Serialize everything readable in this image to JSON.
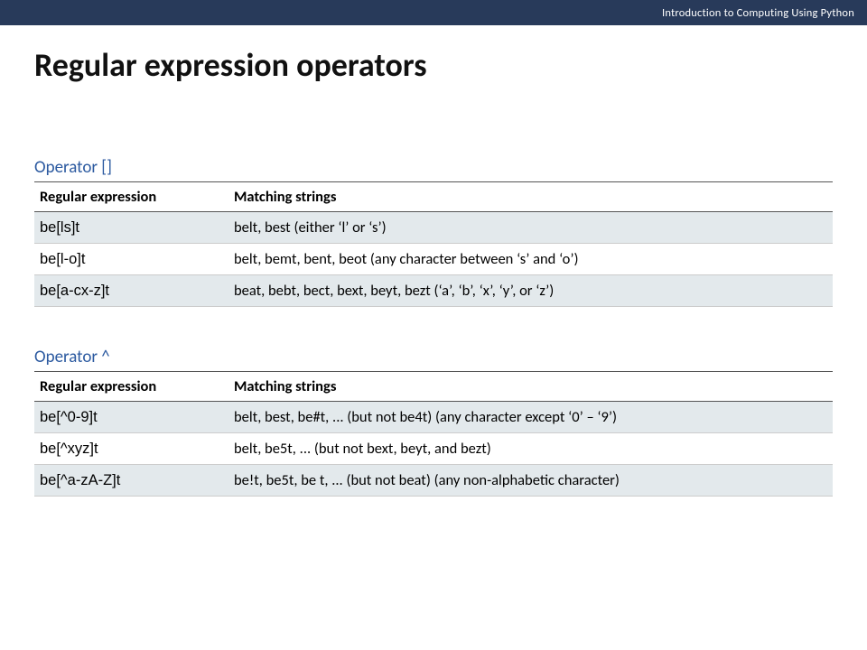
{
  "header": {
    "course": "Introduction to Computing Using Python"
  },
  "title": "Regular expression operators",
  "sections": [
    {
      "label": "Operator []",
      "columns": [
        "Regular expression",
        "Matching strings"
      ],
      "rows": [
        {
          "re": "be[ls]t",
          "match": "belt, best (either ‘l’ or ‘s’)"
        },
        {
          "re": "be[l-o]t",
          "match": "belt, bemt, bent, beot (any character between ‘s’ and ‘o’)"
        },
        {
          "re": "be[a-cx-z]t",
          "match": "beat, bebt, bect, bext, beyt, bezt (‘a’, ‘b’, ‘x’, ‘y’, or ‘z’)"
        }
      ]
    },
    {
      "label": "Operator ^",
      "columns": [
        "Regular expression",
        "Matching strings"
      ],
      "rows": [
        {
          "re": "be[^0-9]t",
          "match": "belt, best, be#t, ... (but not be4t) (any character except ‘0’ – ‘9’)"
        },
        {
          "re": "be[^xyz]t",
          "match": "belt, be5t, ... (but not bext, beyt, and bezt)"
        },
        {
          "re": "be[^a-zA-Z]t",
          "match": "be!t, be5t, be t, ... (but not beat) (any non-alphabetic character)"
        }
      ]
    }
  ]
}
